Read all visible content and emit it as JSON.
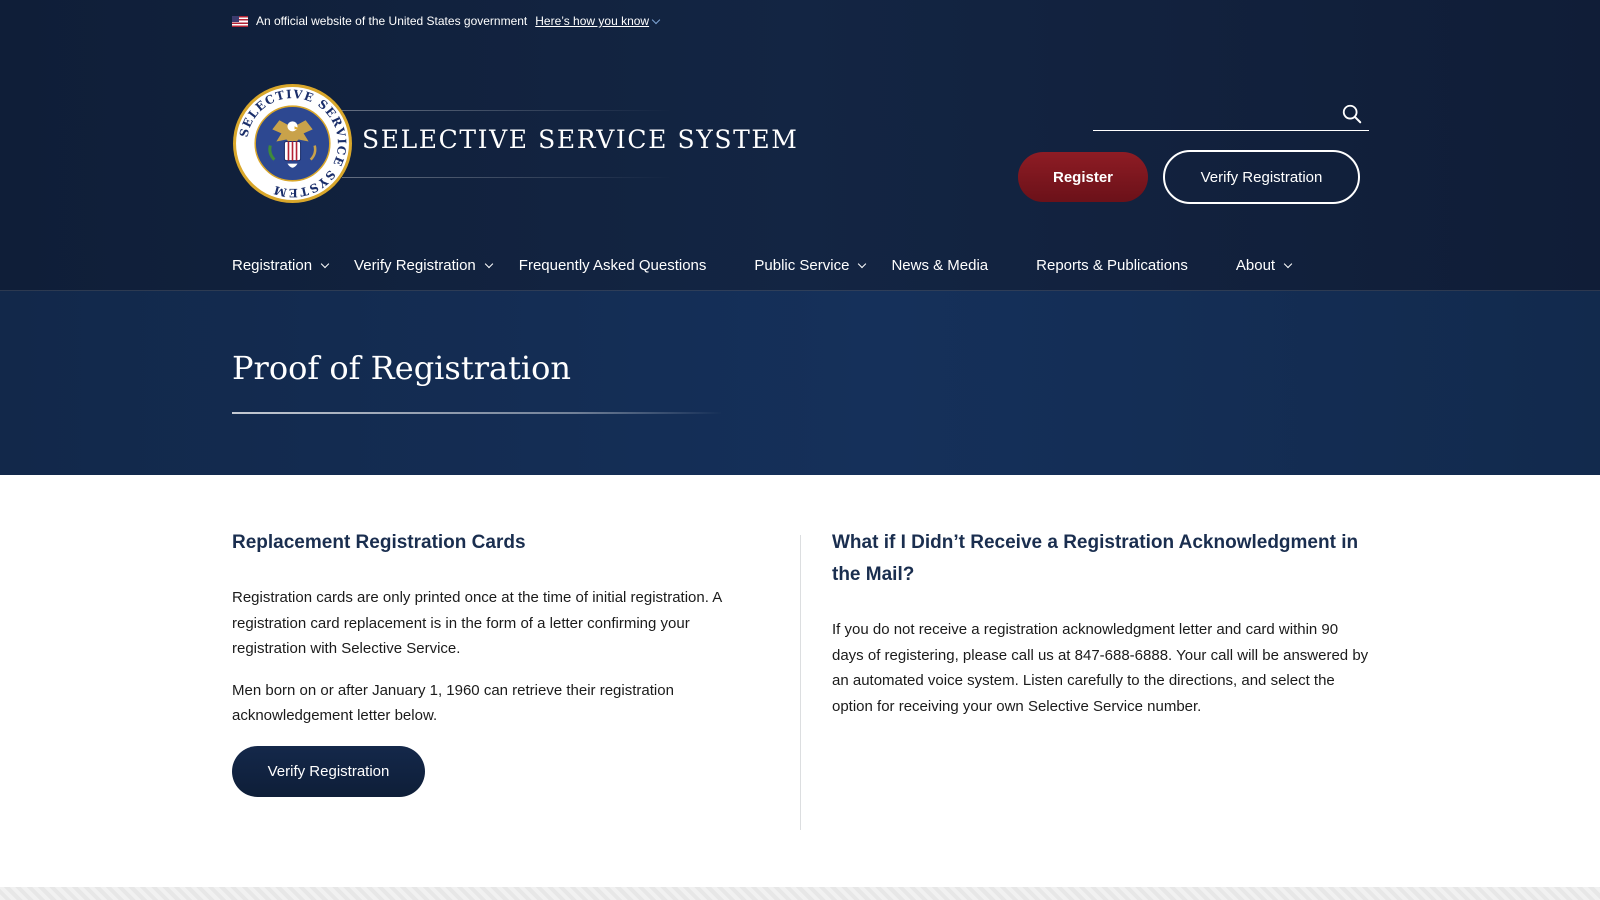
{
  "gov_banner": {
    "text": "An official website of the United States government",
    "link": "Here’s how you know"
  },
  "header": {
    "seal_text": "SELECTIVE SERVICE SYSTEM",
    "agency_name": "SELECTIVE SERVICE SYSTEM",
    "search_placeholder": "",
    "register_label": "Register",
    "verify_label": "Verify Registration"
  },
  "nav": {
    "items": [
      {
        "label": "Registration",
        "has_dropdown": true
      },
      {
        "label": "Verify Registration",
        "has_dropdown": true
      },
      {
        "label": "Frequently Asked Questions",
        "has_dropdown": false
      },
      {
        "label": "Public Service",
        "has_dropdown": true
      },
      {
        "label": "News & Media",
        "has_dropdown": false
      },
      {
        "label": "Reports & Publications",
        "has_dropdown": false
      },
      {
        "label": "About",
        "has_dropdown": true
      }
    ]
  },
  "hero": {
    "title": "Proof of Registration"
  },
  "left": {
    "heading": "Replacement Registration Cards",
    "p1": "Registration cards are only printed once at the time of initial registration. A registration card replacement is in the form of a letter confirming your registration with Selective Service.",
    "p2": "Men born on or after January 1, 1960 can retrieve their registration acknowledgement letter below.",
    "button": "Verify Registration"
  },
  "right": {
    "heading": "What if I Didn’t Receive a Registration Acknowledgment in the Mail?",
    "p1": "If you do not receive a registration acknowledgment letter and card within 90 days of registering, please call us at 847-688-6888. Your call will be answered by an automated voice system. Listen carefully to the directions, and select the option for receiving your own Selective Service number."
  },
  "colors": {
    "header_bg": "#132543",
    "hero_bg": "#15305a",
    "register_red": "#8e1c24",
    "heading_navy": "#1a2e4f",
    "seal_gold": "#d9a72b",
    "seal_blue": "#2d4891"
  },
  "icons": {
    "flag": "us-flag-icon",
    "search": "search-icon",
    "chevron": "chevron-down-icon",
    "seal": "eagle-seal-icon"
  }
}
